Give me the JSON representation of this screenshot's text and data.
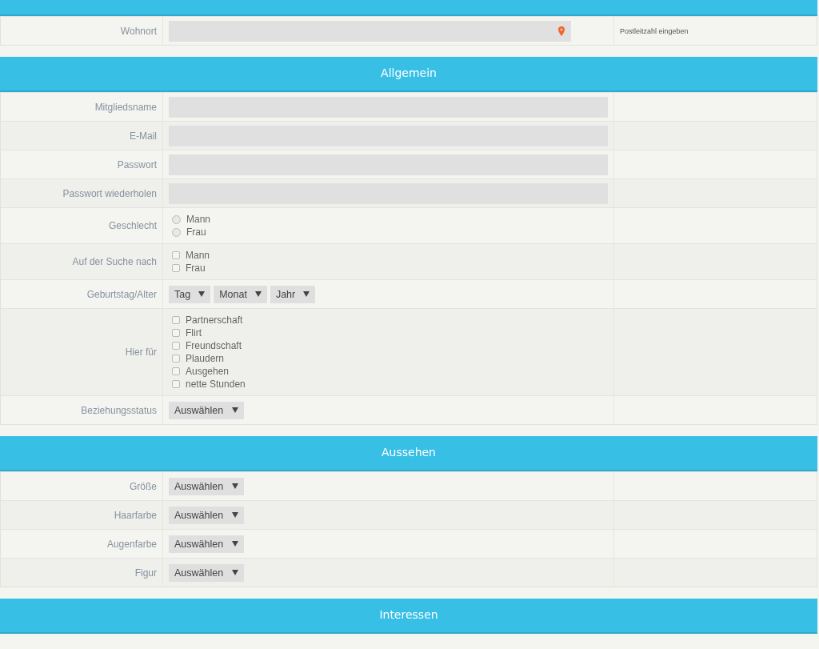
{
  "sections": [
    {
      "rows": [
        {
          "label": "Wohnort",
          "kind": "text",
          "hint": "Postleitzahl eingeben",
          "location_pin": true
        }
      ]
    },
    {
      "title": "Allgemein",
      "rows": [
        {
          "label": "Mitgliedsname",
          "kind": "text"
        },
        {
          "label": "E-Mail",
          "kind": "text"
        },
        {
          "label": "Passwort",
          "kind": "text"
        },
        {
          "label": "Passwort wiederholen",
          "kind": "text"
        },
        {
          "label": "Geschlecht",
          "kind": "radio",
          "options": [
            {
              "label": "Mann",
              "selected": false
            },
            {
              "label": "Frau",
              "selected": false
            }
          ]
        },
        {
          "label": "Auf der Suche nach",
          "kind": "checkbox",
          "options": [
            {
              "label": "Mann",
              "checked": false
            },
            {
              "label": "Frau",
              "checked": false
            }
          ]
        },
        {
          "label": "Geburtstag/Alter",
          "kind": "select",
          "selects": [
            "Tag",
            "Monat",
            "Jahr"
          ]
        },
        {
          "label": "Hier für",
          "kind": "checkbox",
          "options": [
            {
              "label": "Partnerschaft",
              "checked": false
            },
            {
              "label": "Flirt",
              "checked": false
            },
            {
              "label": "Freundschaft",
              "checked": false
            },
            {
              "label": "Plaudern",
              "checked": false
            },
            {
              "label": "Ausgehen",
              "checked": false
            },
            {
              "label": "nette Stunden",
              "checked": false
            }
          ]
        },
        {
          "label": "Beziehungsstatus",
          "kind": "select",
          "selects": [
            "Auswählen"
          ]
        }
      ]
    },
    {
      "title": "Aussehen",
      "rows": [
        {
          "label": "Größe",
          "kind": "select",
          "selects": [
            "Auswählen"
          ]
        },
        {
          "label": "Haarfarbe",
          "kind": "select",
          "selects": [
            "Auswählen"
          ]
        },
        {
          "label": "Augenfarbe",
          "kind": "select",
          "selects": [
            "Auswählen"
          ]
        },
        {
          "label": "Figur",
          "kind": "select",
          "selects": [
            "Auswählen"
          ]
        }
      ]
    },
    {
      "title": "Interessen"
    }
  ]
}
